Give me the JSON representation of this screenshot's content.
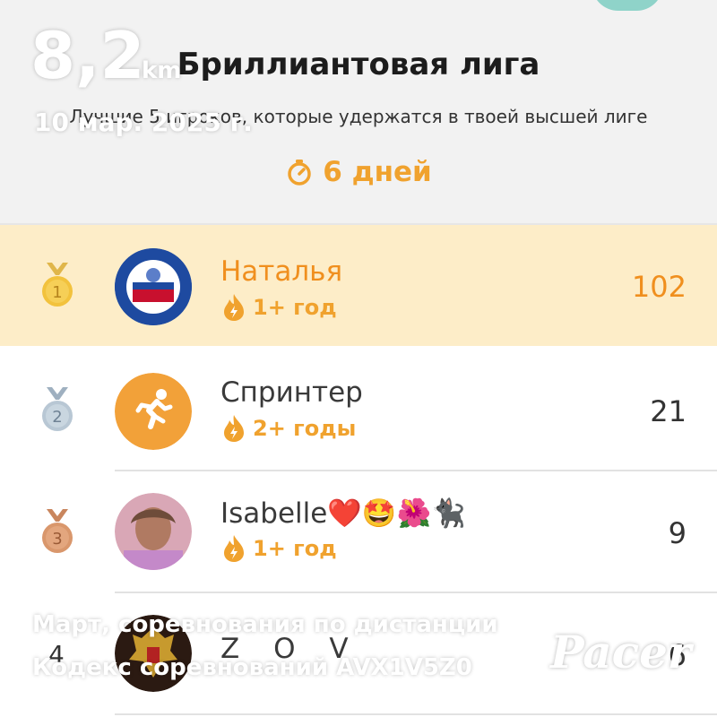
{
  "league": {
    "title": "Бриллиантовая лига",
    "subtitle": "Лучшие 5 игроков, которые удержатся в твоей высшей лиге",
    "timer_text": "6 дней"
  },
  "leaderboard": [
    {
      "rank": "1",
      "name": "Наталья",
      "streak": "1+ год",
      "score": "102",
      "highlight": true,
      "medal": "gold-medal-icon",
      "avatar": "club-logo-avatar"
    },
    {
      "rank": "2",
      "name": "Спринтер",
      "streak": "2+ годы",
      "score": "21",
      "highlight": false,
      "medal": "silver-medal-icon",
      "avatar": "runner-avatar"
    },
    {
      "rank": "3",
      "name": "Isabelle❤️🤩🌺🐈‍⬛",
      "streak": "1+ год",
      "score": "9",
      "highlight": false,
      "medal": "bronze-medal-icon",
      "avatar": "photo-avatar"
    },
    {
      "rank": "4",
      "name": "Z O V",
      "streak": "",
      "score": "6",
      "highlight": false,
      "medal": "",
      "avatar": "emblem-avatar"
    }
  ],
  "overlay": {
    "distance_value": "8,2",
    "distance_unit": "km",
    "date": "10 мар. 2025 г.",
    "competition_line1": "Март, соревнования по дистанции",
    "competition_line2": "Кодекс соревнований AVX1V5Z0",
    "logo_text": "Pacer"
  },
  "colors": {
    "accent_orange": "#f0a22e",
    "highlight_row": "#fdedc8",
    "header_bg": "#f2f2f2"
  }
}
